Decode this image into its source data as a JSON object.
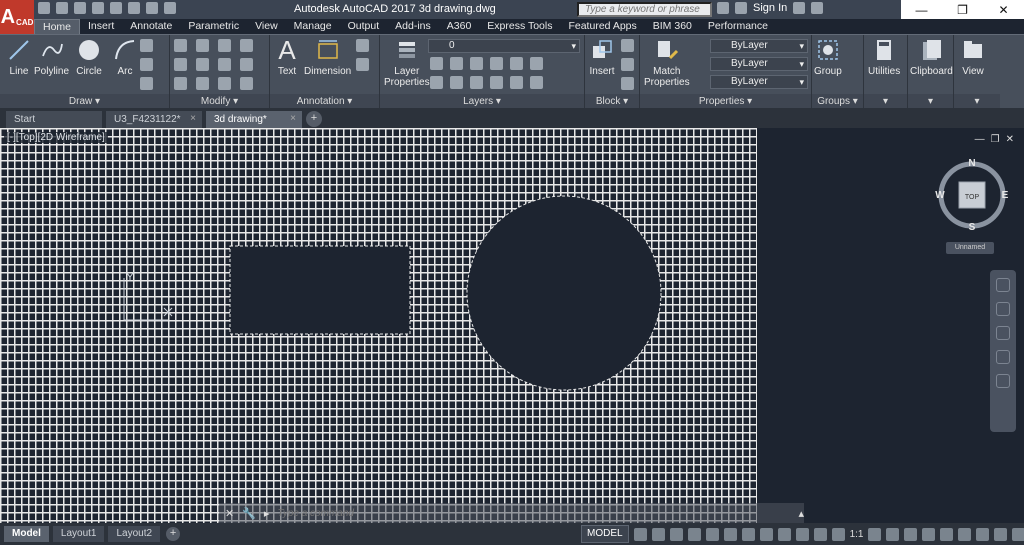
{
  "app": {
    "logo": "A",
    "logo_sub": "CAD",
    "title": "Autodesk AutoCAD 2017   3d drawing.dwg",
    "search_placeholder": "Type a keyword or phrase",
    "sign_in": "Sign In",
    "win_minimize": "—",
    "win_restore": "❐",
    "win_close": "✕"
  },
  "ribbon_tabs": [
    "Home",
    "Insert",
    "Annotate",
    "Parametric",
    "View",
    "Manage",
    "Output",
    "Add-ins",
    "A360",
    "Express Tools",
    "Featured Apps",
    "BIM 360",
    "Performance"
  ],
  "ribbon": {
    "draw": {
      "label": "Draw ▾",
      "line": "Line",
      "polyline": "Polyline",
      "circle": "Circle",
      "arc": "Arc"
    },
    "modify": {
      "label": "Modify ▾"
    },
    "annotation": {
      "label": "Annotation ▾",
      "text": "Text",
      "dimension": "Dimension"
    },
    "layers": {
      "label": "Layers ▾",
      "layer_properties_1": "Layer",
      "layer_properties_2": "Properties",
      "current_layer": "0"
    },
    "block": {
      "label": "Block ▾",
      "insert": "Insert"
    },
    "properties": {
      "label": "Properties ▾",
      "match_1": "Match",
      "match_2": "Properties",
      "color": "ByLayer",
      "linetype": "ByLayer",
      "lineweight": "ByLayer"
    },
    "groups": {
      "label": "Groups ▾",
      "group": "Group"
    },
    "utilities": {
      "label": "Utilities"
    },
    "clipboard": {
      "label": "Clipboard"
    },
    "view": {
      "label": "View"
    }
  },
  "doc_tabs": [
    {
      "label": "Start"
    },
    {
      "label": "U3_F4231122*"
    },
    {
      "label": "3d drawing*"
    }
  ],
  "viewport": {
    "label": "[-][Top][2D Wireframe]",
    "compass": {
      "n": "N",
      "s": "S",
      "e": "E",
      "w": "W",
      "top": "TOP"
    },
    "ucs": "Unnamed"
  },
  "command_line": {
    "placeholder": "Type a command"
  },
  "status": {
    "layout_tabs": [
      "Model",
      "Layout1",
      "Layout2"
    ],
    "model": "MODEL",
    "scale": "1:1"
  },
  "colors": {
    "canvas": "#1d2430",
    "hatch": "#e8e8e8",
    "ribbon": "#474f5b",
    "logo": "#c0392b"
  }
}
